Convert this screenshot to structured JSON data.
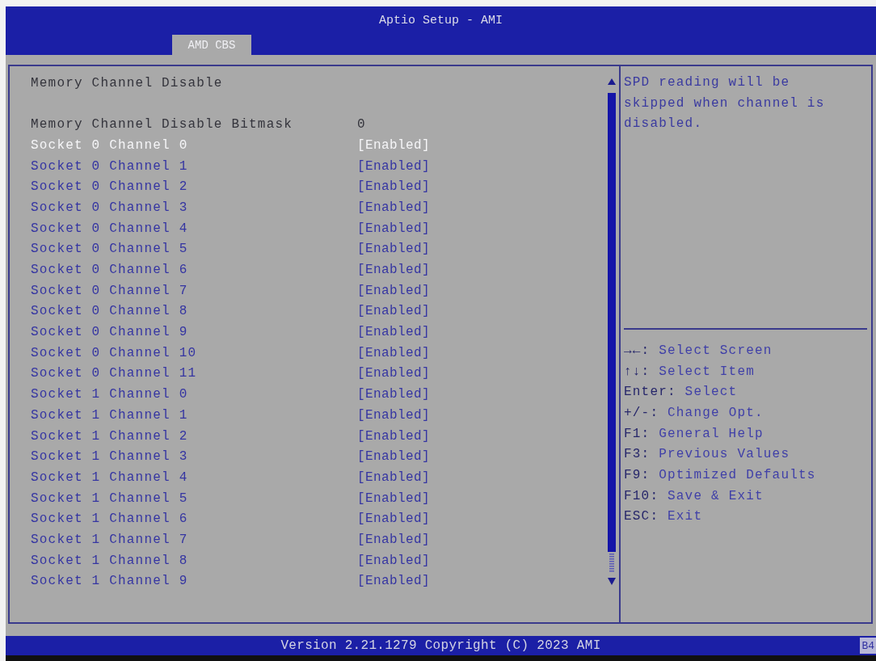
{
  "window": {
    "title": "Aptio Setup - AMI"
  },
  "tabs": [
    {
      "label": "AMD CBS",
      "selected": true
    }
  ],
  "settings": {
    "heading": "Memory Channel Disable",
    "items": [
      {
        "kind": "info",
        "label": "Memory Channel Disable Bitmask",
        "value": "0",
        "selected": false
      },
      {
        "kind": "option",
        "label": "Socket 0 Channel 0",
        "value": "[Enabled]",
        "selected": true
      },
      {
        "kind": "option",
        "label": "Socket 0 Channel 1",
        "value": "[Enabled]",
        "selected": false
      },
      {
        "kind": "option",
        "label": "Socket 0 Channel 2",
        "value": "[Enabled]",
        "selected": false
      },
      {
        "kind": "option",
        "label": "Socket 0 Channel 3",
        "value": "[Enabled]",
        "selected": false
      },
      {
        "kind": "option",
        "label": "Socket 0 Channel 4",
        "value": "[Enabled]",
        "selected": false
      },
      {
        "kind": "option",
        "label": "Socket 0 Channel 5",
        "value": "[Enabled]",
        "selected": false
      },
      {
        "kind": "option",
        "label": "Socket 0 Channel 6",
        "value": "[Enabled]",
        "selected": false
      },
      {
        "kind": "option",
        "label": "Socket 0 Channel 7",
        "value": "[Enabled]",
        "selected": false
      },
      {
        "kind": "option",
        "label": "Socket 0 Channel 8",
        "value": "[Enabled]",
        "selected": false
      },
      {
        "kind": "option",
        "label": "Socket 0 Channel 9",
        "value": "[Enabled]",
        "selected": false
      },
      {
        "kind": "option",
        "label": "Socket 0 Channel 10",
        "value": "[Enabled]",
        "selected": false
      },
      {
        "kind": "option",
        "label": "Socket 0 Channel 11",
        "value": "[Enabled]",
        "selected": false
      },
      {
        "kind": "option",
        "label": "Socket 1 Channel 0",
        "value": "[Enabled]",
        "selected": false
      },
      {
        "kind": "option",
        "label": "Socket 1 Channel 1",
        "value": "[Enabled]",
        "selected": false
      },
      {
        "kind": "option",
        "label": "Socket 1 Channel 2",
        "value": "[Enabled]",
        "selected": false
      },
      {
        "kind": "option",
        "label": "Socket 1 Channel 3",
        "value": "[Enabled]",
        "selected": false
      },
      {
        "kind": "option",
        "label": "Socket 1 Channel 4",
        "value": "[Enabled]",
        "selected": false
      },
      {
        "kind": "option",
        "label": "Socket 1 Channel 5",
        "value": "[Enabled]",
        "selected": false
      },
      {
        "kind": "option",
        "label": "Socket 1 Channel 6",
        "value": "[Enabled]",
        "selected": false
      },
      {
        "kind": "option",
        "label": "Socket 1 Channel 7",
        "value": "[Enabled]",
        "selected": false
      },
      {
        "kind": "option",
        "label": "Socket 1 Channel 8",
        "value": "[Enabled]",
        "selected": false
      },
      {
        "kind": "option",
        "label": "Socket 1 Channel 9",
        "value": "[Enabled]",
        "selected": false
      }
    ]
  },
  "help": {
    "text": "SPD reading will be skipped when channel is disabled."
  },
  "key_hints": [
    {
      "key": "→←:",
      "action": "Select Screen"
    },
    {
      "key": "↑↓:",
      "action": "Select Item"
    },
    {
      "key": "Enter:",
      "action": "Select"
    },
    {
      "key": "+/-:",
      "action": "Change Opt."
    },
    {
      "key": "F1:",
      "action": "General Help"
    },
    {
      "key": "F3:",
      "action": "Previous Values"
    },
    {
      "key": "F9:",
      "action": "Optimized Defaults"
    },
    {
      "key": "F10:",
      "action": "Save & Exit"
    },
    {
      "key": "ESC:",
      "action": "Exit"
    }
  ],
  "status_bar": {
    "text": "Version 2.21.1279 Copyright (C) 2023 AMI",
    "code": "B4"
  }
}
